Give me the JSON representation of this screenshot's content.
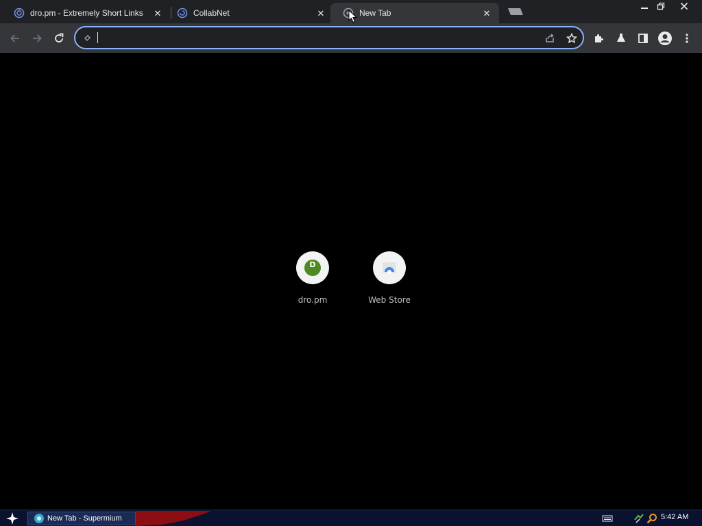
{
  "window": {
    "title": "New Tab - Supermium"
  },
  "tabs": [
    {
      "title": "dro.pm - Extremely Short Links",
      "icon": "dropm-favicon",
      "active": false
    },
    {
      "title": "CollabNet",
      "icon": "collabnet-favicon",
      "active": false
    },
    {
      "title": "New Tab",
      "icon": "newtab-favicon",
      "active": true
    }
  ],
  "omnibox": {
    "value": "",
    "placeholder": ""
  },
  "shortcuts": [
    {
      "label": "dro.pm",
      "icon_letter": "D",
      "icon_color": "#4e8a1f"
    },
    {
      "label": "Web Store",
      "icon": "web-store-icon"
    }
  ],
  "taskbar": {
    "task_label": "New Tab - Supermium",
    "clock": "5:42 AM"
  },
  "colors": {
    "accent": "#8ab4f8",
    "toolbar": "#35363a",
    "tabstrip": "#202124",
    "page_bg": "#000000",
    "taskbar": "#0a1230"
  }
}
